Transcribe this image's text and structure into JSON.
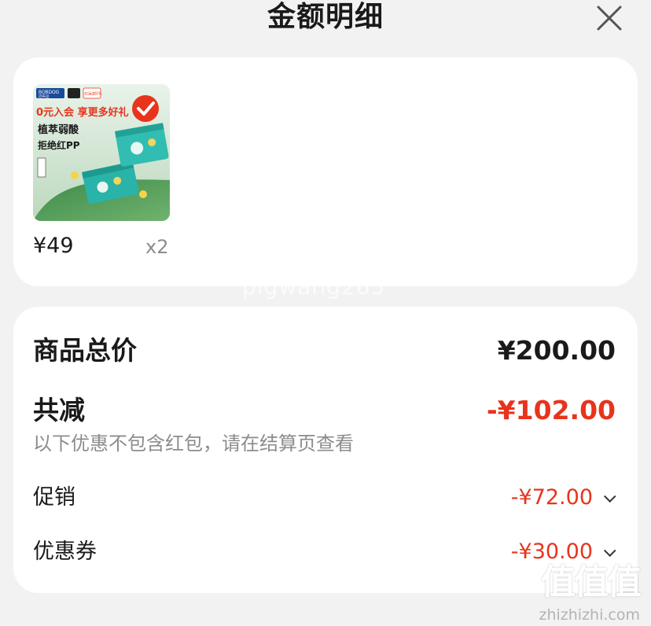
{
  "header": {
    "title": "金额明细",
    "close_icon": "close-icon"
  },
  "product": {
    "image": {
      "brand": "BOBDOG",
      "brand_sub": "巴布豆",
      "promo": "0元入会 享更多好礼",
      "headline_line1": "植萃弱酸",
      "headline_line2": "拒绝红PP",
      "badge": "红运送好礼"
    },
    "price": "¥49",
    "quantity": "x2"
  },
  "watermark": "pigwang265",
  "summary": {
    "total_label": "商品总价",
    "total_value": "¥200.00",
    "discount_label": "共减",
    "discount_value": "-¥102.00",
    "hint": "以下优惠不包含红包，请在结算页查看",
    "items": [
      {
        "label": "促销",
        "value": "-¥72.00"
      },
      {
        "label": "优惠券",
        "value": "-¥30.00"
      }
    ]
  },
  "site_logo": {
    "glyphs": "值值值",
    "url": "zhizhizhi.com"
  },
  "colors": {
    "accent_red": "#e8341c",
    "card_bg": "#ffffff",
    "page_bg": "#f2f2f2"
  }
}
